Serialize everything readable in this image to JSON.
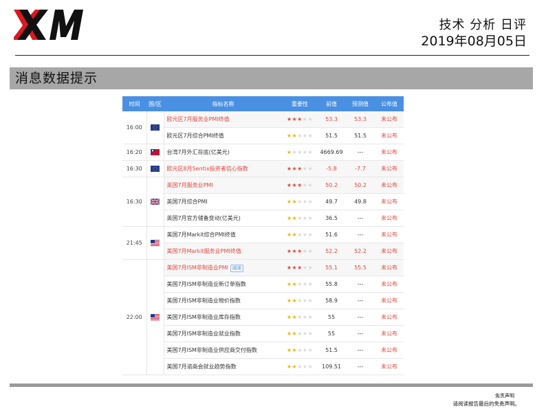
{
  "header": {
    "logo_text": "XM",
    "report_title": "技术 分析 日评",
    "report_date": "2019年08月05日"
  },
  "section": {
    "title": "消息数据提示"
  },
  "table": {
    "columns": [
      "时间",
      "国/区",
      "指标名称",
      "重要性",
      "前值",
      "预测值",
      "公布值"
    ],
    "groups": [
      {
        "time": "16:00",
        "flag": "eu-flag-icon",
        "rows": [
          {
            "name": "欧元区7月服务业PMI终值",
            "stars": 3,
            "prev": "53.3",
            "forecast": "53.3",
            "actual": "未公布",
            "highlight": true,
            "tag": ""
          },
          {
            "name": "欧元区7月综合PMI终值",
            "stars": 2,
            "prev": "51.5",
            "forecast": "51.5",
            "actual": "未公布",
            "highlight": false,
            "tag": ""
          }
        ]
      },
      {
        "time": "16:20",
        "flag": "taiwan-flag-icon",
        "rows": [
          {
            "name": "台湾7月外汇存底(亿美元)",
            "stars": 1,
            "prev": "4669.69",
            "forecast": "---",
            "actual": "未公布",
            "highlight": false,
            "tag": ""
          }
        ]
      },
      {
        "time": "16:30",
        "flag": "eu-flag-icon",
        "rows": [
          {
            "name": "欧元区8月Sentix投资者信心指数",
            "stars": 3,
            "prev": "-5.8",
            "forecast": "-7.7",
            "actual": "未公布",
            "highlight": true,
            "tag": ""
          }
        ]
      },
      {
        "time": "16:30",
        "flag": "uk-flag-icon",
        "rows": [
          {
            "name": "英国7月服务业PMI",
            "stars": 3,
            "prev": "50.2",
            "forecast": "50.2",
            "actual": "未公布",
            "highlight": true,
            "tag": ""
          },
          {
            "name": "英国7月综合PMI",
            "stars": 2,
            "prev": "49.7",
            "forecast": "49.8",
            "actual": "未公布",
            "highlight": false,
            "tag": ""
          },
          {
            "name": "英国7月官方储备变动(亿美元)",
            "stars": 2,
            "prev": "36.5",
            "forecast": "---",
            "actual": "未公布",
            "highlight": false,
            "tag": ""
          }
        ]
      },
      {
        "time": "21:45",
        "flag": "us-flag-icon",
        "rows": [
          {
            "name": "美国7月Markit综合PMI终值",
            "stars": 2,
            "prev": "51.6",
            "forecast": "---",
            "actual": "未公布",
            "highlight": false,
            "tag": ""
          },
          {
            "name": "美国7月Markit服务业PMI终值",
            "stars": 3,
            "prev": "52.2",
            "forecast": "52.2",
            "actual": "未公布",
            "highlight": true,
            "tag": ""
          }
        ]
      },
      {
        "time": "22:00",
        "flag": "us-flag-icon",
        "rows": [
          {
            "name": "美国7月ISM非制造业PMI",
            "stars": 3,
            "prev": "55.1",
            "forecast": "55.5",
            "actual": "未公布",
            "highlight": true,
            "tag": "阅读"
          },
          {
            "name": "美国7月ISM非制造业新订单指数",
            "stars": 2,
            "prev": "55.8",
            "forecast": "---",
            "actual": "未公布",
            "highlight": false,
            "tag": ""
          },
          {
            "name": "美国7月ISM非制造业物价指数",
            "stars": 2,
            "prev": "58.9",
            "forecast": "---",
            "actual": "未公布",
            "highlight": false,
            "tag": ""
          },
          {
            "name": "美国7月ISM非制造业库存指数",
            "stars": 2,
            "prev": "55",
            "forecast": "---",
            "actual": "未公布",
            "highlight": false,
            "tag": ""
          },
          {
            "name": "美国7月ISM非制造业就业指数",
            "stars": 2,
            "prev": "55",
            "forecast": "---",
            "actual": "未公布",
            "highlight": false,
            "tag": ""
          },
          {
            "name": "美国7月ISM非制造业供应商交付指数",
            "stars": 2,
            "prev": "51.5",
            "forecast": "---",
            "actual": "未公布",
            "highlight": false,
            "tag": ""
          },
          {
            "name": "美国7月谘商会就业趋势指数",
            "stars": 2,
            "prev": "109.51",
            "forecast": "---",
            "actual": "未公布",
            "highlight": false,
            "tag": ""
          }
        ]
      }
    ]
  },
  "footer": {
    "disclaimer_title": "免责声明",
    "disclaimer_text": "请阅读报告最后的免责声明。"
  },
  "colors": {
    "header_blue": "#4a90e2",
    "highlight_red": "#e2463d",
    "star_gold": "#f5b400",
    "section_gray": "#a7a7a7"
  }
}
